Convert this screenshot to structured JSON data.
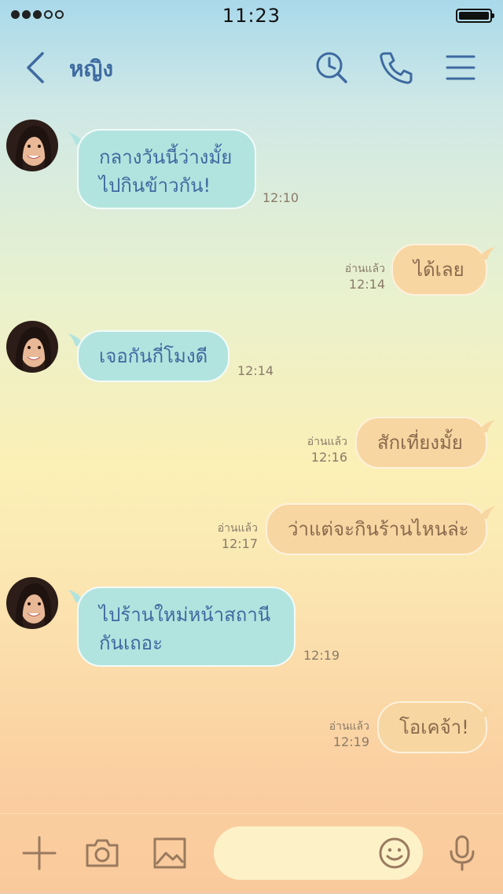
{
  "status_bar": {
    "time": "11:23",
    "signal_dots": 3,
    "signal_total": 5
  },
  "header": {
    "contact_name": "หญิง"
  },
  "messages": [
    {
      "side": "in",
      "lines": [
        "กลางวันนี้ว่างมั้ย",
        "ไปกินข้าวกัน!"
      ],
      "time": "12:10"
    },
    {
      "side": "out",
      "text": "ได้เลย",
      "read": "อ่านแล้ว",
      "time": "12:14"
    },
    {
      "side": "in",
      "lines": [
        "เจอกันกี่โมงดี"
      ],
      "time": "12:14"
    },
    {
      "side": "out",
      "text": "สักเที่ยงมั้ย",
      "read": "อ่านแล้ว",
      "time": "12:16"
    },
    {
      "side": "out",
      "text": "ว่าแต่จะกินร้านไหนล่ะ",
      "read": "อ่านแล้ว",
      "time": "12:17"
    },
    {
      "side": "in",
      "lines": [
        "ไปร้านใหม่หน้าสถานี",
        "กันเถอะ"
      ],
      "time": "12:19"
    },
    {
      "side": "out",
      "text": "โอเคจ้า!",
      "read": "อ่านแล้ว",
      "time": "12:19"
    }
  ],
  "composer": {
    "placeholder": ""
  },
  "icons": {
    "back": "chevron-left-icon",
    "search": "clock-search-icon",
    "call": "phone-icon",
    "menu": "hamburger-menu-icon",
    "add": "plus-icon",
    "camera": "camera-icon",
    "image": "image-icon",
    "emoji": "smiley-icon",
    "mic": "microphone-icon"
  },
  "colors": {
    "header_accent": "#3e6aa0",
    "incoming_bubble": "#b2e4df",
    "outgoing_bubble": "#f7d6a2",
    "toolbar_icon": "#9a7a5e"
  }
}
